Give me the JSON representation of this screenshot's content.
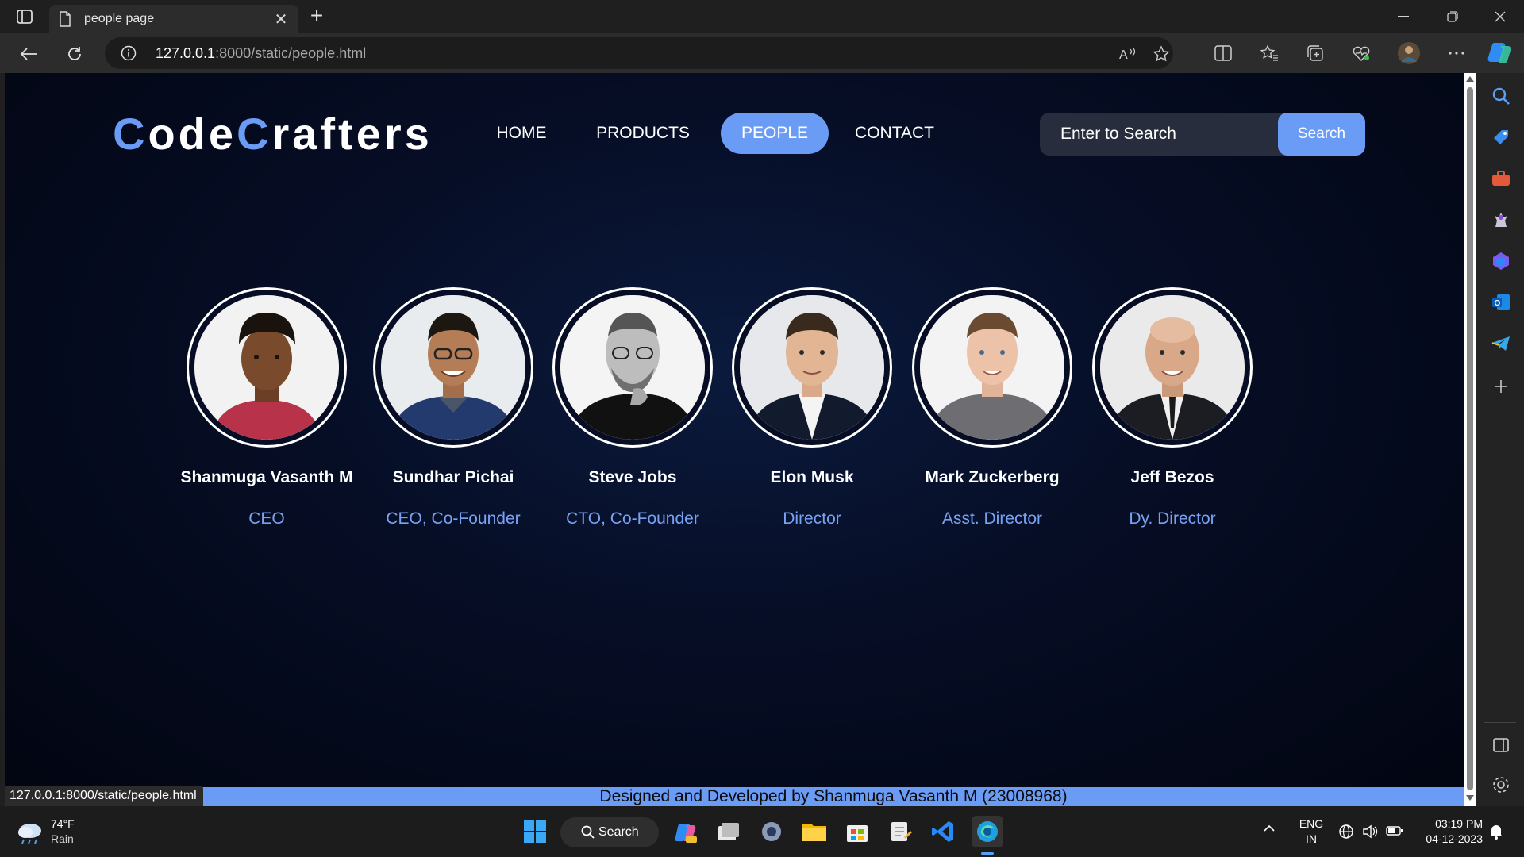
{
  "browser": {
    "tab_title": "people page",
    "url_host": "127.0.0.1",
    "url_path": ":8000/static/people.html",
    "status_url": "127.0.0.1:8000/static/people.html"
  },
  "site": {
    "logo": {
      "part1_accent": "C",
      "part1_rest": "ode",
      "part2_accent": "C",
      "part2_rest": "rafters"
    },
    "nav": [
      {
        "label": "HOME",
        "active": false
      },
      {
        "label": "PRODUCTS",
        "active": false
      },
      {
        "label": "PEOPLE",
        "active": true
      },
      {
        "label": "CONTACT",
        "active": false
      }
    ],
    "search": {
      "placeholder": "Enter to Search",
      "button": "Search"
    },
    "people": [
      {
        "name": "Shanmuga Vasanth M",
        "role": "CEO"
      },
      {
        "name": "Sundhar Pichai",
        "role": "CEO, Co-Founder"
      },
      {
        "name": "Steve Jobs",
        "role": "CTO, Co-Founder"
      },
      {
        "name": "Elon Musk",
        "role": "Director"
      },
      {
        "name": "Mark Zuckerberg",
        "role": "Asst. Director"
      },
      {
        "name": "Jeff Bezos",
        "role": "Dy. Director"
      }
    ],
    "footer": "Designed and Developed by Shanmuga Vasanth M (23008968)"
  },
  "taskbar": {
    "weather_temp": "74°F",
    "weather_cond": "Rain",
    "search_label": "Search",
    "lang_top": "ENG",
    "lang_bottom": "IN",
    "time": "03:19 PM",
    "date": "04-12-2023"
  },
  "colors": {
    "accent": "#6b9cf5",
    "page_bg": "#060d24"
  }
}
